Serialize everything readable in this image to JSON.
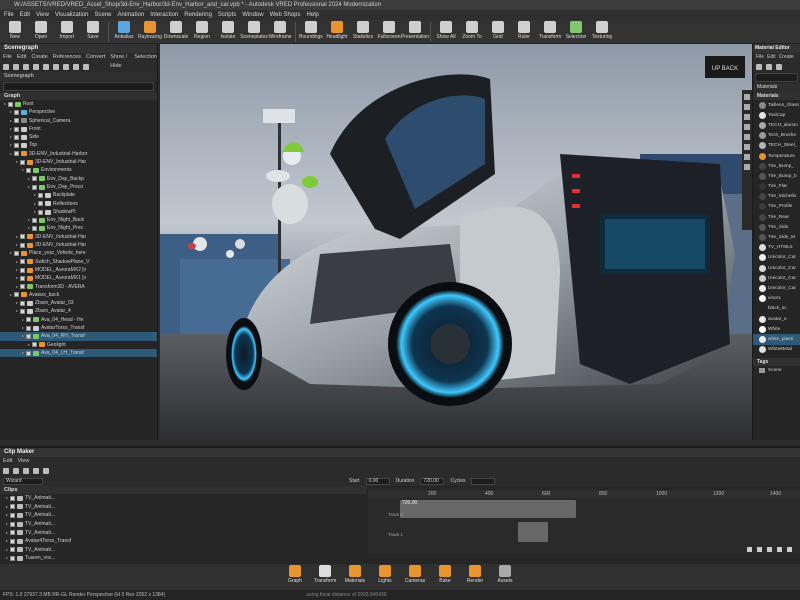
{
  "window": {
    "title": "W:/ASSETS/VRED/VRED_Asset_Shop/3d-Env_Harbor/3d-Env_Harbor_and_car.vpb * - Autodesk VRED Professional 2024 Modernization"
  },
  "menu": [
    "File",
    "Edit",
    "View",
    "Visualization",
    "Scene",
    "Animation",
    "Interaction",
    "Rendering",
    "Scripts",
    "Window",
    "Web Shops",
    "Help"
  ],
  "toolbar": [
    "New",
    "Open",
    "Import",
    "Save",
    "Antialias",
    "Raytracing",
    "Downscale",
    "Region",
    "Isolate",
    "Sceneplates",
    "Wireframe",
    "Boundings",
    "Headlight",
    "Statistics",
    "Fullscreen",
    "Presentation",
    "Show All",
    "Zoom To",
    "Grid",
    "Ruler",
    "Transform",
    "Selection",
    "Texturing"
  ],
  "scenegraph": {
    "title": "Scenegraph",
    "menu": [
      "File",
      "Edit",
      "Create",
      "References",
      "Convert",
      "Show / Hide",
      "Selection"
    ],
    "subtitle": "Scenegraph",
    "graph_header": "Graph",
    "items": [
      {
        "label": "Root",
        "indent": 0,
        "color": "#7ec86a",
        "sel": false
      },
      {
        "label": "Perspective",
        "indent": 1,
        "color": "#5fb0e0",
        "sel": false
      },
      {
        "label": "Spherical_Camera",
        "indent": 1,
        "color": "#888",
        "sel": false
      },
      {
        "label": "Front",
        "indent": 1,
        "color": "#ccc",
        "sel": false
      },
      {
        "label": "Side",
        "indent": 1,
        "color": "#ccc",
        "sel": false
      },
      {
        "label": "Top",
        "indent": 1,
        "color": "#ccc",
        "sel": false
      },
      {
        "label": "3D-ENV_Industrial-Harbor",
        "indent": 1,
        "color": "#e8952e",
        "sel": false
      },
      {
        "label": "3D-ENV_Industrial-Har",
        "indent": 2,
        "color": "#e8952e",
        "sel": false
      },
      {
        "label": "Environments",
        "indent": 3,
        "color": "#7ec86a",
        "sel": false
      },
      {
        "label": "Env_Day_Backp",
        "indent": 4,
        "color": "#7ec86a",
        "sel": false
      },
      {
        "label": "Env_Day_Preco",
        "indent": 4,
        "color": "#7ec86a",
        "sel": false
      },
      {
        "label": "Backplate",
        "indent": 5,
        "color": "#ccc",
        "sel": false
      },
      {
        "label": "Reflections",
        "indent": 5,
        "color": "#ccc",
        "sel": false
      },
      {
        "label": "ShadowPl",
        "indent": 5,
        "color": "#ccc",
        "sel": false
      },
      {
        "label": "Env_Night_Back",
        "indent": 4,
        "color": "#7ec86a",
        "sel": false
      },
      {
        "label": "Env_Night_Prec",
        "indent": 4,
        "color": "#7ec86a",
        "sel": false
      },
      {
        "label": "3D-ENV_Industrial-Har",
        "indent": 2,
        "color": "#e8952e",
        "sel": false
      },
      {
        "label": "3D-ENV_Industrial-Har",
        "indent": 2,
        "color": "#e8952e",
        "sel": false
      },
      {
        "label": "Place_your_Vehicle_here",
        "indent": 1,
        "color": "#e8952e",
        "sel": false
      },
      {
        "label": "Switch_ShadowPlane_V",
        "indent": 2,
        "color": "#e8952e",
        "sel": false
      },
      {
        "label": "MODEL_AuroraMX2 [v",
        "indent": 2,
        "color": "#e8952e",
        "sel": false
      },
      {
        "label": "MODEL_AuroraMX1 [v",
        "indent": 2,
        "color": "#e8952e",
        "sel": false
      },
      {
        "label": "Transform3D - AVERA",
        "indent": 2,
        "color": "#7ec86a",
        "sel": false
      },
      {
        "label": "Avatars_back",
        "indent": 1,
        "color": "#e8952e",
        "sel": false
      },
      {
        "label": "Zbaro_Avatar_03",
        "indent": 2,
        "color": "#ccc",
        "sel": false
      },
      {
        "label": "Zbaro_Avatar_4",
        "indent": 2,
        "color": "#ccc",
        "sel": false
      },
      {
        "label": "Ava_04_Head - He",
        "indent": 3,
        "color": "#7ec86a",
        "sel": false
      },
      {
        "label": "AvatarTorso_Transf",
        "indent": 3,
        "color": "#ccc",
        "sel": false
      },
      {
        "label": "Ava_04_RH_Transf",
        "indent": 3,
        "color": "#7ec86a",
        "sel": true
      },
      {
        "label": "Geolight",
        "indent": 4,
        "color": "#e8952e",
        "sel": false
      },
      {
        "label": "Ava_04_LH_Transf",
        "indent": 3,
        "color": "#7ec86a",
        "sel": true
      }
    ]
  },
  "materials": {
    "title": "Material Editor",
    "menu": [
      "File",
      "Edit",
      "Create"
    ],
    "subtitle": "Materials",
    "header": "Materials",
    "items": [
      {
        "label": "Taillens_Glass",
        "color": "#8a8a8a"
      },
      {
        "label": "TaxiCap",
        "color": "#e6e6e6"
      },
      {
        "label": "TECH_alumin",
        "color": "#aaaaaa"
      },
      {
        "label": "Tech_Brushe",
        "color": "#9a9a9a"
      },
      {
        "label": "TECH_Steel_",
        "color": "#b5b5b5"
      },
      {
        "label": "Temperature",
        "color": "#e8952e"
      },
      {
        "label": "Tire_Bump_",
        "color": "#444"
      },
      {
        "label": "Tire_Bump_b",
        "color": "#555"
      },
      {
        "label": "Tire_Flat",
        "color": "#333"
      },
      {
        "label": "Tire_Michelin",
        "color": "#444"
      },
      {
        "label": "Tire_Profile",
        "color": "#3a3a3a"
      },
      {
        "label": "Tire_Rear",
        "color": "#444"
      },
      {
        "label": "Tire_Side",
        "color": "#555"
      },
      {
        "label": "Tire_Side_M",
        "color": "#555"
      },
      {
        "label": "TV_HTML5",
        "color": "#dddddd"
      },
      {
        "label": "Unicolor_Car",
        "color": "#eeeeee"
      },
      {
        "label": "Unicolor_Car",
        "color": "#dddddd"
      },
      {
        "label": "Unicolor_Car",
        "color": "#cccccc"
      },
      {
        "label": "Unicolor_Car",
        "color": "#eeeeee"
      },
      {
        "label": "visor1",
        "color": "#ffffff"
      },
      {
        "label": "black_sc",
        "color": "#222"
      },
      {
        "label": "avatar_e",
        "color": "#e6e6e6"
      },
      {
        "label": "White",
        "color": "#ffffff"
      },
      {
        "label": "white_plasti",
        "color": "#f0f0f0"
      },
      {
        "label": "WhiteMetal",
        "color": "#e0e0e0"
      }
    ],
    "tags_header": "Tags",
    "tags_item": "Scene"
  },
  "viewport": {
    "view_label": "UP BACK"
  },
  "clipmaker": {
    "title": "Clip Maker",
    "menu": [
      "Edit",
      "View"
    ],
    "wizard": "Wizard",
    "start_label": "Start",
    "start_value": "0.00",
    "duration_label": "Duration",
    "duration_value": "720.00",
    "cycles_label": "Cycles",
    "clips_header": "Clips",
    "clips": [
      "TV_Animati...",
      "TV_Animati...",
      "TV_Animati...",
      "TV_Animati...",
      "TV_Animati...",
      "Avatar4Torso_Transf",
      "TV_Animati...",
      "Tuuren_voc...",
      "Tuuren_voc..."
    ],
    "ruler_ticks": [
      "200",
      "400",
      "600",
      "800",
      "1000",
      "1200",
      "1400"
    ],
    "bar_label": "720.00",
    "track0": "Track 0",
    "track1": "Track 1"
  },
  "bottom_tabs": [
    "Graph",
    "Transform",
    "Materials",
    "Lights",
    "Cameras",
    "Bake",
    "Render",
    "Assets"
  ],
  "status": "FPS: 1.0   27937.3 MB   RR-GL   Render Perspective (Id 0 Res 2052 x 1384)",
  "status_note": "using focal distance of 2993.940430"
}
